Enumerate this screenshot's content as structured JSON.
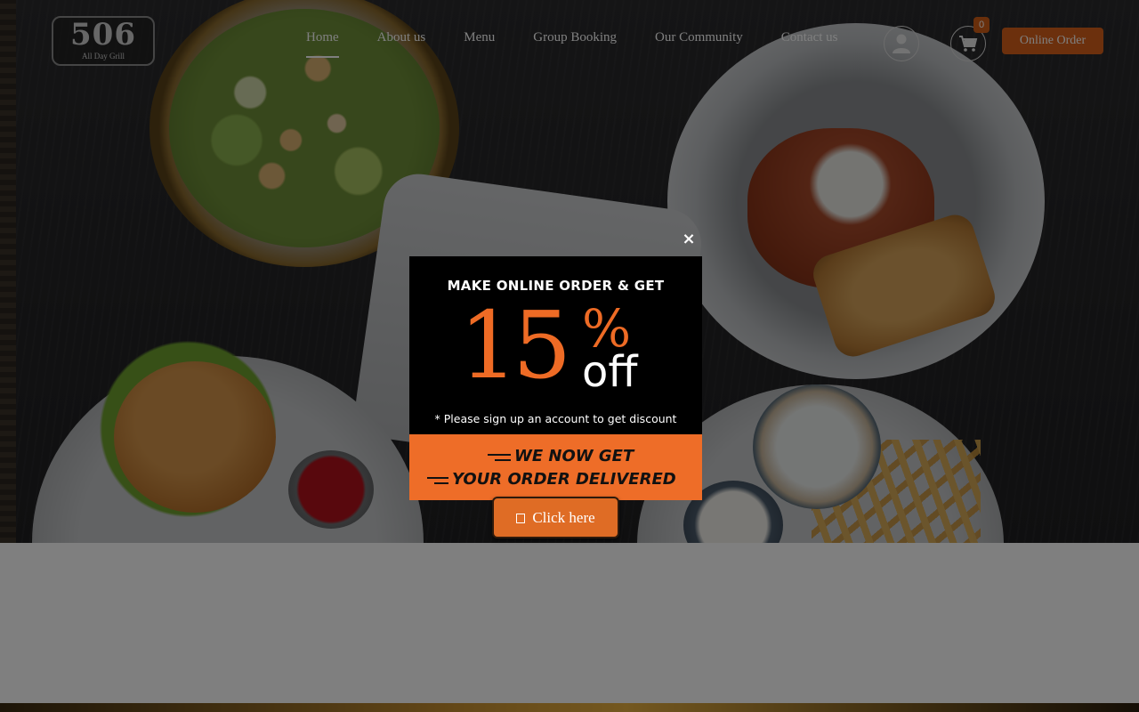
{
  "logo": {
    "number": "506",
    "tagline": "All Day Grill"
  },
  "nav": {
    "items": [
      {
        "label": "Home",
        "active": true
      },
      {
        "label": "About us"
      },
      {
        "label": "Menu"
      },
      {
        "label": "Group Booking"
      },
      {
        "label": "Our Community"
      },
      {
        "label": "Contact us"
      }
    ]
  },
  "header": {
    "cart_count": "0",
    "online_order_label": "Online Order",
    "user_icon": "user-icon",
    "cart_icon": "cart-icon"
  },
  "popup": {
    "headline": "MAKE ONLINE ORDER & GET",
    "discount_number": "15",
    "discount_symbol": "%",
    "discount_word": "off",
    "note": "* Please sign up an account to get discount",
    "band_line1": "WE NOW GET",
    "band_line2": "YOUR ORDER DELIVERED",
    "close_symbol": "×",
    "cta_label": "Click here"
  },
  "colors": {
    "accent": "#df6c25",
    "popup_orange": "#ee6d28",
    "overlay": "rgba(0,0,0,0.5)"
  }
}
